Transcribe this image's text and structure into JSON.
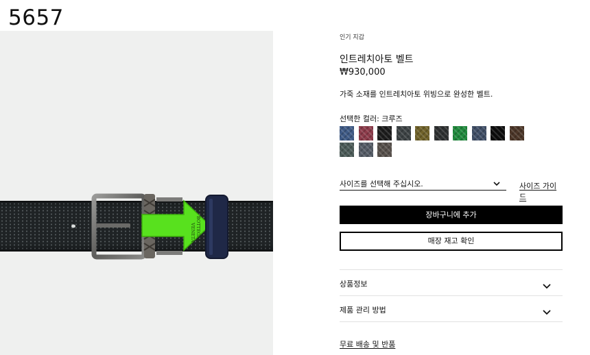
{
  "image_id_label": "5657",
  "product": {
    "breadcrumb": "인기 지갑",
    "title": "인트레치아토 벨트",
    "price": "₩930,000",
    "description": "가죽 소재를 인트레치아토 위빙으로 완성한 벨트.",
    "buckle_text_1": "BOTTEGA",
    "buckle_text_2": "VENETA"
  },
  "color": {
    "label": "선택한 컬러: 크루즈",
    "swatches": [
      {
        "name": "swatch-navy-blue",
        "color": "#3e5a86"
      },
      {
        "name": "swatch-burgundy",
        "color": "#8d3b4a"
      },
      {
        "name": "swatch-black",
        "color": "#1c1c1c"
      },
      {
        "name": "swatch-dark-slate",
        "color": "#3c4244"
      },
      {
        "name": "swatch-olive",
        "color": "#6f6128"
      },
      {
        "name": "swatch-charcoal",
        "color": "#2d2f30"
      },
      {
        "name": "swatch-green",
        "color": "#1f8a3c"
      },
      {
        "name": "swatch-steel-blue",
        "color": "#3f4e66"
      },
      {
        "name": "swatch-jet-black",
        "color": "#0c0c0c"
      },
      {
        "name": "swatch-brown",
        "color": "#4b3527"
      },
      {
        "name": "swatch-teal-grey",
        "color": "#4b5b58"
      },
      {
        "name": "swatch-grey-blue",
        "color": "#555c66"
      },
      {
        "name": "swatch-taupe",
        "color": "#57504b"
      }
    ]
  },
  "size": {
    "placeholder": "사이즈를 선택해 주십시오.",
    "guide_label": "사이즈 가이드"
  },
  "buttons": {
    "add_to_cart": "장바구니에 추가",
    "check_store_stock": "매장 재고 확인"
  },
  "accordions": [
    {
      "label": "상품정보"
    },
    {
      "label": "제품 관리 방법"
    }
  ],
  "shipping_link": "무료 배송 및 반품",
  "colors": {
    "accent_green": "#58e11e",
    "button_black": "#000000",
    "image_bg": "#eff0ef"
  }
}
